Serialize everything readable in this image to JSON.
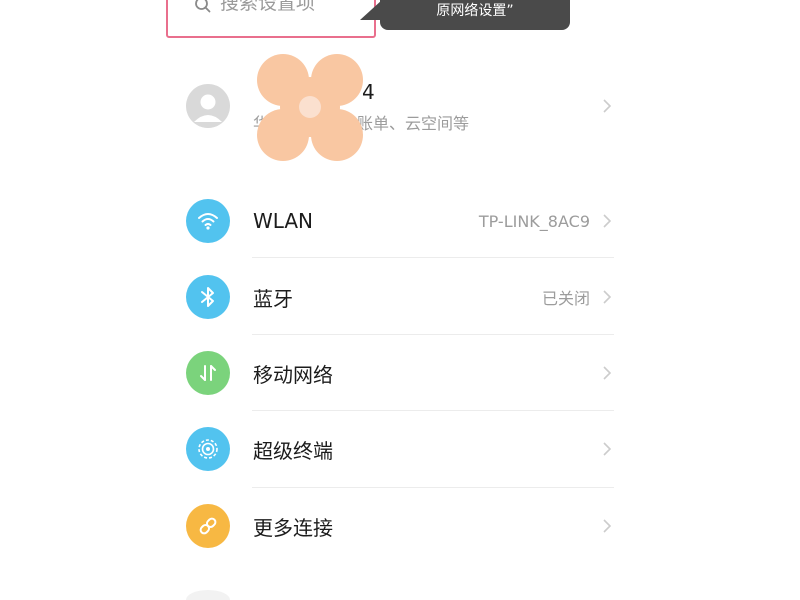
{
  "search": {
    "placeholder": "搜索设置项"
  },
  "callout": {
    "text": "原网络设置”"
  },
  "account": {
    "title_fragment": "4",
    "subtitle_prefix": "华",
    "subtitle_suffix": "款与账单、云空间等",
    "avatar_icon": "user-avatar-icon"
  },
  "settings": {
    "items": [
      {
        "label": "WLAN",
        "value": "TP-LINK_8AC9",
        "icon": "wifi-icon",
        "color": "#52c3ef"
      },
      {
        "label": "蓝牙",
        "value": "已关闭",
        "icon": "bluetooth-icon",
        "color": "#52c3ef"
      },
      {
        "label": "移动网络",
        "value": "",
        "icon": "mobile-data-icon",
        "color": "#7bd37c"
      },
      {
        "label": "超级终端",
        "value": "",
        "icon": "super-device-icon",
        "color": "#52c3ef"
      },
      {
        "label": "更多连接",
        "value": "",
        "icon": "link-icon",
        "color": "#f7b843"
      }
    ]
  },
  "colors": {
    "highlight_frame": "#e96f8d",
    "callout_bg": "#4a4a4a",
    "flower": "#f9c7a2"
  }
}
